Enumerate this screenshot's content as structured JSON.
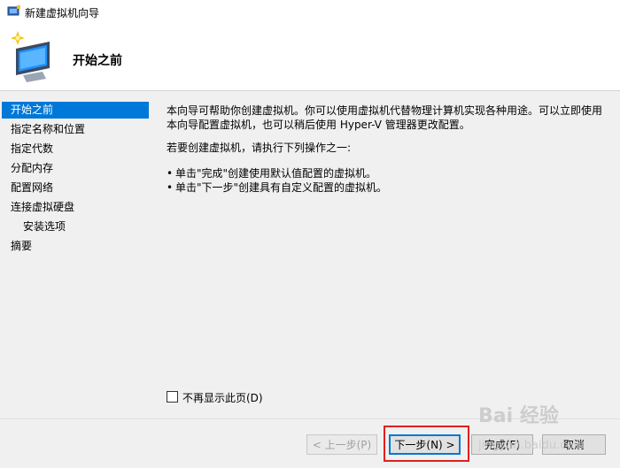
{
  "window": {
    "title": "新建虚拟机向导"
  },
  "header": {
    "title": "开始之前"
  },
  "nav": {
    "items": [
      {
        "label": "开始之前",
        "selected": true
      },
      {
        "label": "指定名称和位置",
        "selected": false
      },
      {
        "label": "指定代数",
        "selected": false
      },
      {
        "label": "分配内存",
        "selected": false
      },
      {
        "label": "配置网络",
        "selected": false
      },
      {
        "label": "连接虚拟硬盘",
        "selected": false
      },
      {
        "label": "安装选项",
        "selected": false
      },
      {
        "label": "摘要",
        "selected": false
      }
    ]
  },
  "content": {
    "intro": "本向导可帮助你创建虚拟机。你可以使用虚拟机代替物理计算机实现各种用途。可以立即使用本向导配置虚拟机，也可以稍后使用 Hyper-V 管理器更改配置。",
    "prompt": "若要创建虚拟机，请执行下列操作之一:",
    "bullets": [
      "单击\"完成\"创建使用默认值配置的虚拟机。",
      "单击\"下一步\"创建具有自定义配置的虚拟机。"
    ]
  },
  "checkbox": {
    "label": "不再显示此页(D)",
    "checked": false
  },
  "buttons": {
    "prev": "< 上一步(P)",
    "next": "下一步(N) >",
    "finish": "完成(F)",
    "cancel": "取消"
  },
  "watermark": {
    "logo": "Bai 经验",
    "site": "jingyan.baidu.com"
  },
  "colors": {
    "selection": "#0078d7",
    "highlight": "#e0201f"
  }
}
